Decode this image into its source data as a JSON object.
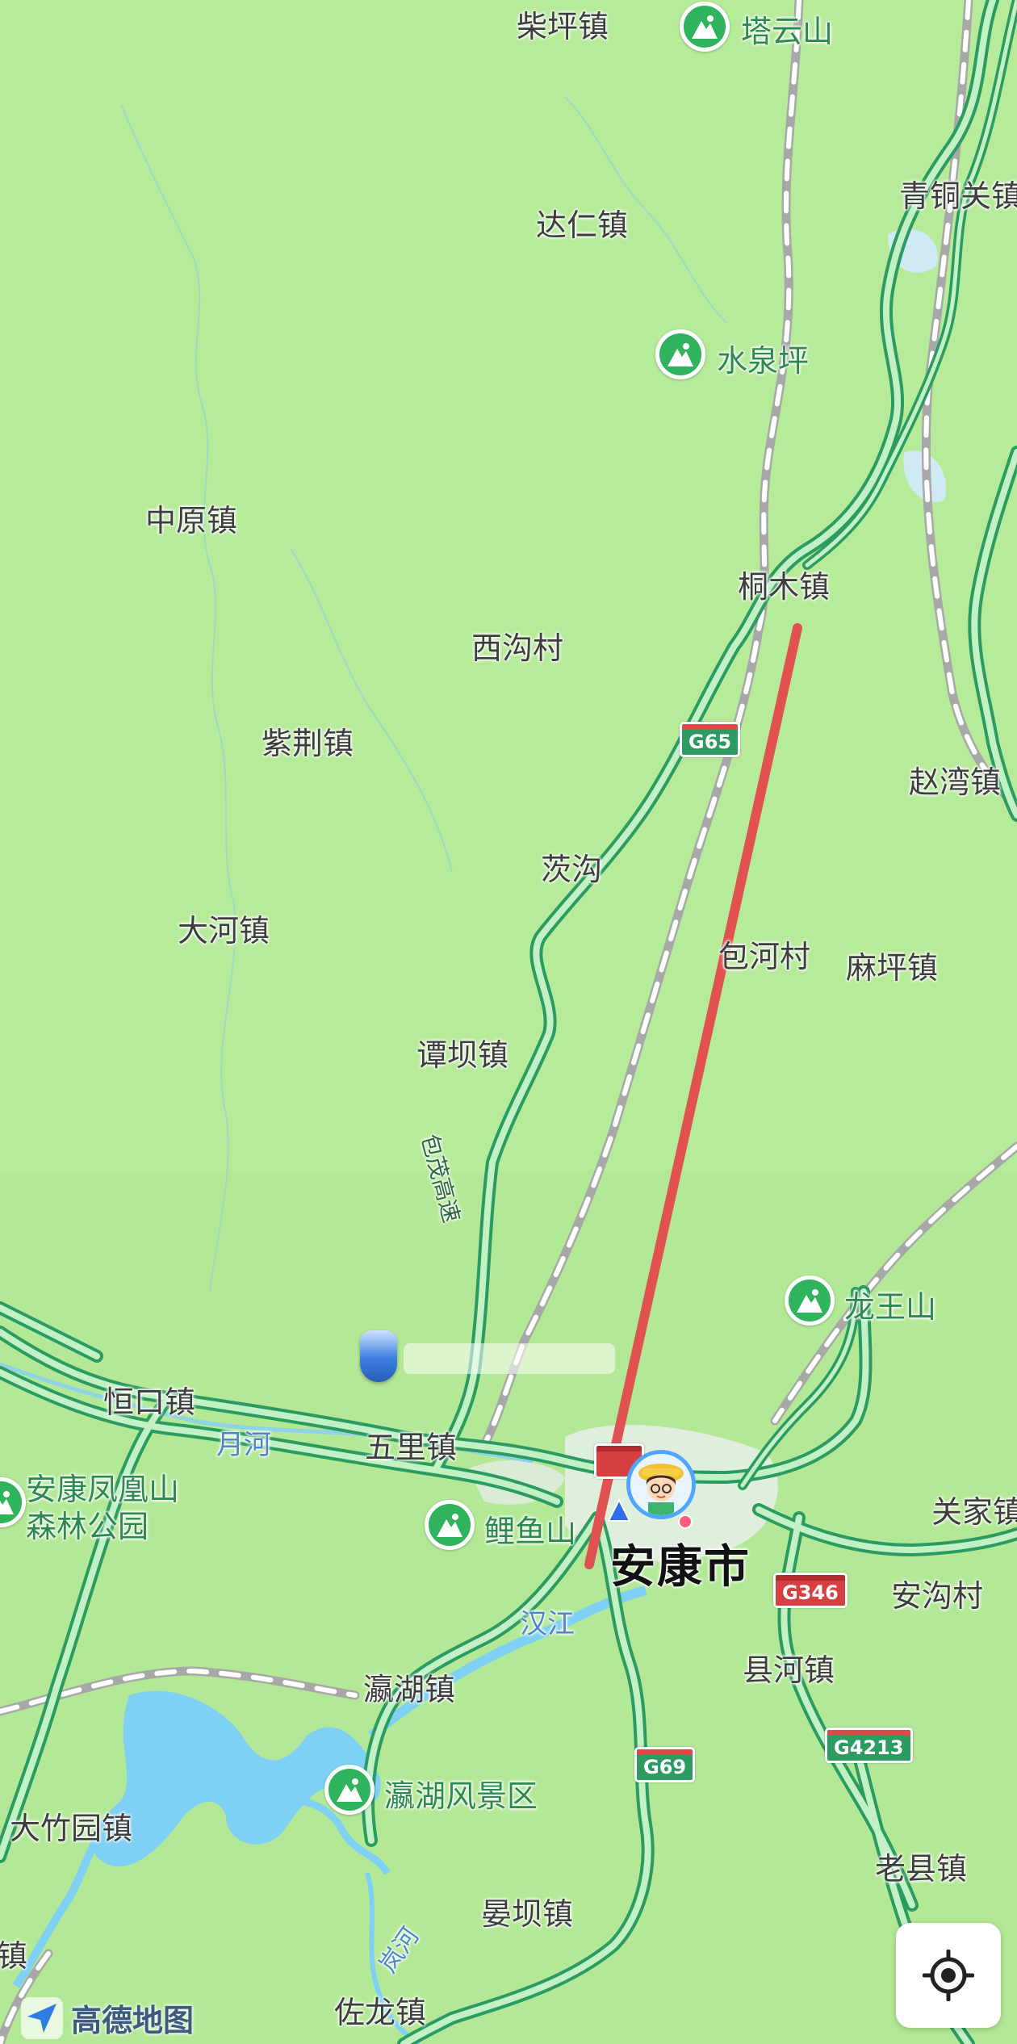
{
  "places": {
    "chaiping": "柴坪镇",
    "tayunshan": "塔云山",
    "qingtongguan": "青铜关镇",
    "daren": "达仁镇",
    "shuiquanping": "水泉坪",
    "zhongyuan": "中原镇",
    "tongmu": "桐木镇",
    "xigoucun": "西沟村",
    "zijing": "紫荆镇",
    "zhaowan": "赵湾镇",
    "cigou": "茨沟",
    "dahe": "大河镇",
    "baohecun": "包河村",
    "maping": "麻坪镇",
    "tanba": "谭坝镇",
    "longwangshan": "龙王山",
    "hengkou": "恒口镇",
    "wuli": "五里镇",
    "fenghuangshan": "安康凤凰山",
    "fenghuangshan2": "森林公园",
    "liyushan": "鲤鱼山",
    "ankang": "安康市",
    "guanjia": "关家镇",
    "ankangcun": "安沟村",
    "xianhe": "县河镇",
    "yinghu": "瀛湖镇",
    "yinghufengjing": "瀛湖风景区",
    "dazhuyuan": "大竹园镇",
    "laoxian": "老县镇",
    "yanba": "晏坝镇",
    "zuolong": "佐龙镇",
    "edge_zhen": "镇"
  },
  "rivers": {
    "yuehe": "月河",
    "hanjiang": "汉江",
    "lanhe": "岚河"
  },
  "roads": {
    "baomao": "包茂高速",
    "g65": "G65",
    "g69": "G69",
    "g346": "G346",
    "g4213": "G4213"
  },
  "brand": "高德地图",
  "colors": {
    "land": "#b6eb9a",
    "highway": "#2c9b62",
    "river": "#7fd0f5",
    "measure_line": "#e05252",
    "poi": "#2fb35c"
  },
  "icons": {
    "poi": "mountain-icon",
    "locate": "locate-crosshair-icon",
    "brand": "amap-arrow-icon"
  }
}
